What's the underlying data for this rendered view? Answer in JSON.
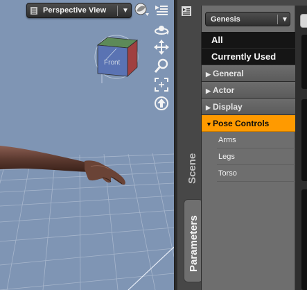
{
  "viewport": {
    "camera_select": {
      "label": "Perspective View",
      "arrow": "▼"
    },
    "view_cube": {
      "front_label": "Front"
    },
    "tools": {
      "orbit": "orbit-icon",
      "pan": "pan-icon",
      "zoom": "zoom-icon",
      "frame": "frame-icon",
      "home": "home-icon"
    }
  },
  "pane_tabs": {
    "scene": "Scene",
    "parameters": "Parameters"
  },
  "parameters": {
    "node_select": {
      "label": "Genesis",
      "arrow": "▼"
    },
    "categories": [
      {
        "label": "All",
        "kind": "top"
      },
      {
        "label": "Currently Used",
        "kind": "top"
      },
      {
        "label": "General",
        "kind": "group",
        "expanded": false,
        "marker": "▶"
      },
      {
        "label": "Actor",
        "kind": "group",
        "expanded": false,
        "marker": "▶"
      },
      {
        "label": "Display",
        "kind": "group",
        "expanded": false,
        "marker": "▶"
      },
      {
        "label": "Pose Controls",
        "kind": "group",
        "expanded": true,
        "selected": true,
        "marker": "▼"
      }
    ],
    "pose_controls_children": [
      "Arms",
      "Legs",
      "Torso"
    ]
  },
  "colors": {
    "viewport_bg": "#7f95b4",
    "selected_category": "#ff9a00"
  }
}
